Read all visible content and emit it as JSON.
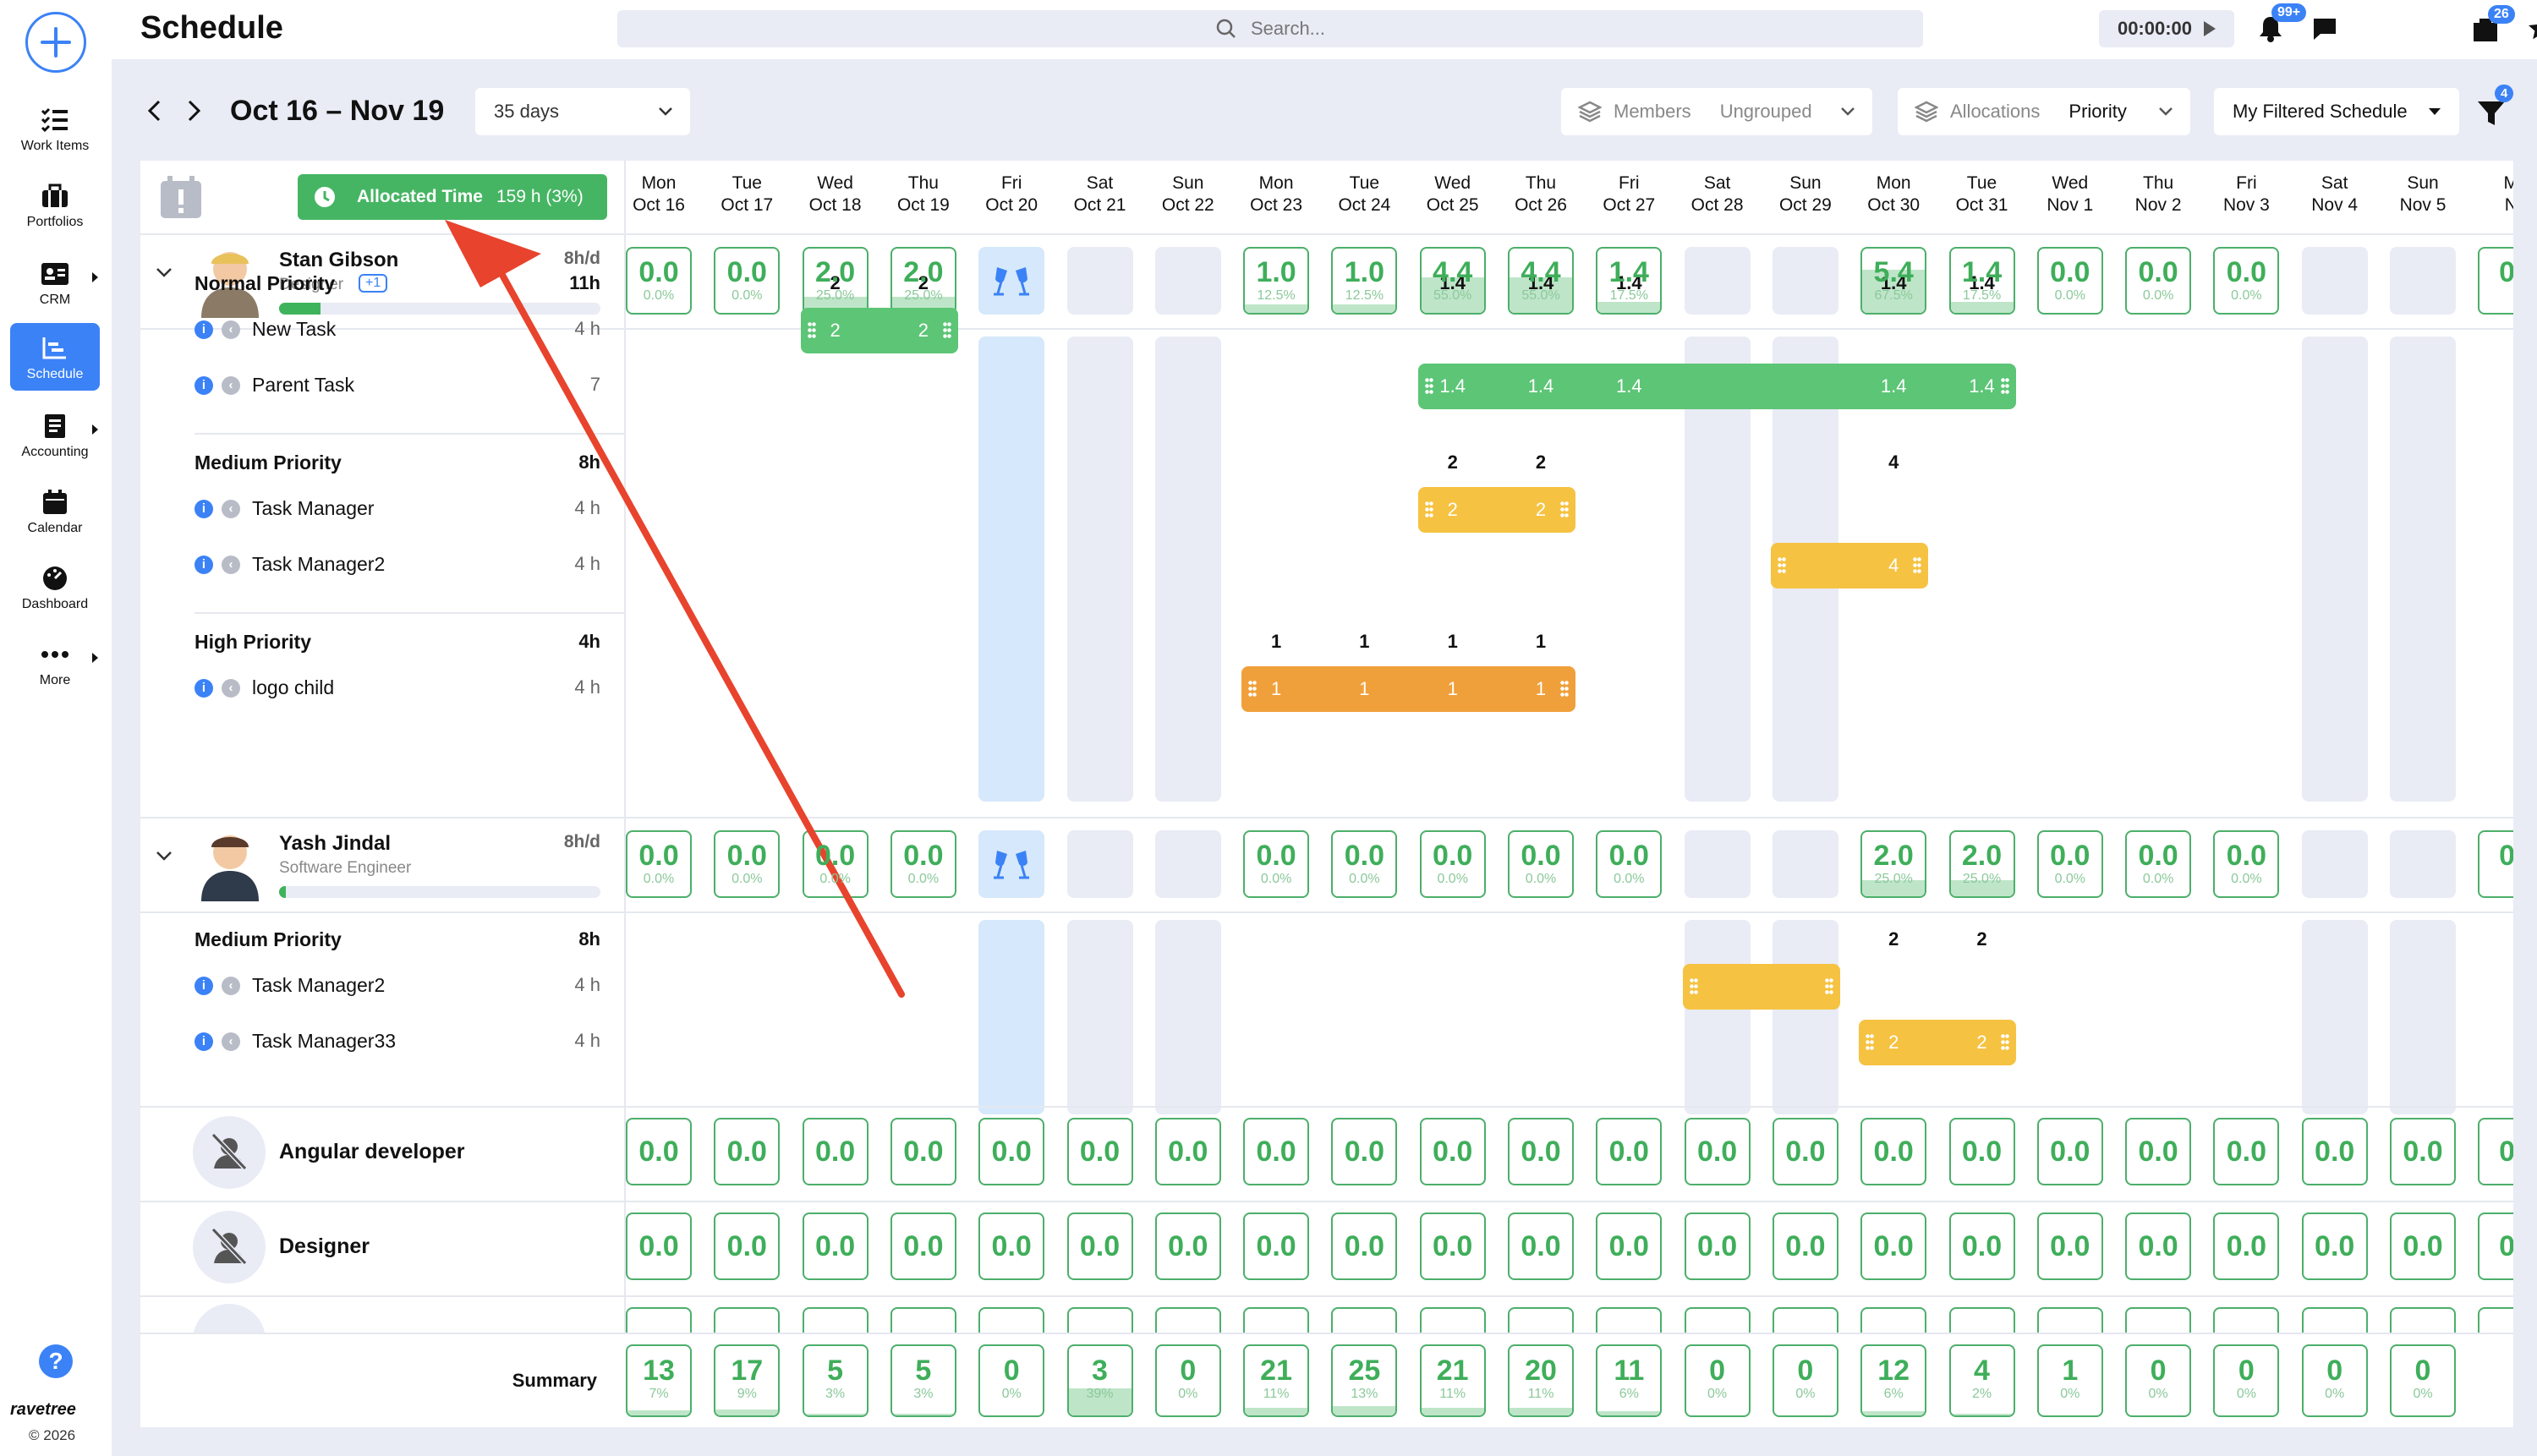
{
  "app": {
    "title": "Schedule",
    "brand": "ravetree",
    "copyright": "© 2026"
  },
  "sidebar": {
    "items": [
      {
        "label": "Work Items",
        "icon": "work-items-icon"
      },
      {
        "label": "Portfolios",
        "icon": "portfolio-icon"
      },
      {
        "label": "CRM",
        "icon": "crm-icon"
      },
      {
        "label": "Schedule",
        "icon": "schedule-icon"
      },
      {
        "label": "Accounting",
        "icon": "accounting-icon"
      },
      {
        "label": "Calendar",
        "icon": "calendar-icon"
      },
      {
        "label": "Dashboard",
        "icon": "dashboard-icon"
      },
      {
        "label": "More",
        "icon": "more-icon"
      }
    ]
  },
  "header": {
    "search_placeholder": "Search...",
    "timer": "00:00:00",
    "notifications_badge": "99+",
    "inbox_badge": "26"
  },
  "toolbar": {
    "date_range": "Oct 16 – Nov 19",
    "range_select": "35 days",
    "members_label": "Members",
    "grouping": "Ungrouped",
    "allocations_label": "Allocations",
    "allocations_value": "Priority",
    "filter_select": "My Filtered Schedule",
    "filter_badge": "4"
  },
  "allocated": {
    "label": "Allocated Time",
    "value": "159 h (3%)"
  },
  "days": [
    {
      "dow": "Mon",
      "date": "Oct 16"
    },
    {
      "dow": "Tue",
      "date": "Oct 17"
    },
    {
      "dow": "Wed",
      "date": "Oct 18"
    },
    {
      "dow": "Thu",
      "date": "Oct 19"
    },
    {
      "dow": "Fri",
      "date": "Oct 20"
    },
    {
      "dow": "Sat",
      "date": "Oct 21"
    },
    {
      "dow": "Sun",
      "date": "Oct 22"
    },
    {
      "dow": "Mon",
      "date": "Oct 23"
    },
    {
      "dow": "Tue",
      "date": "Oct 24"
    },
    {
      "dow": "Wed",
      "date": "Oct 25"
    },
    {
      "dow": "Thu",
      "date": "Oct 26"
    },
    {
      "dow": "Fri",
      "date": "Oct 27"
    },
    {
      "dow": "Sat",
      "date": "Oct 28"
    },
    {
      "dow": "Sun",
      "date": "Oct 29"
    },
    {
      "dow": "Mon",
      "date": "Oct 30"
    },
    {
      "dow": "Tue",
      "date": "Oct 31"
    },
    {
      "dow": "Wed",
      "date": "Nov 1"
    },
    {
      "dow": "Thu",
      "date": "Nov 2"
    },
    {
      "dow": "Fri",
      "date": "Nov 3"
    },
    {
      "dow": "Sat",
      "date": "Nov 4"
    },
    {
      "dow": "Sun",
      "date": "Nov 5"
    },
    {
      "dow": "M",
      "date": "N"
    }
  ],
  "members": [
    {
      "name": "Stan Gibson",
      "role": "Designer",
      "extra": "+1",
      "capacity": "8h/d",
      "progress": 0.13,
      "cells": [
        {
          "v": "0.0",
          "p": "0.0%",
          "fill": 0
        },
        {
          "v": "0.0",
          "p": "0.0%",
          "fill": 0
        },
        {
          "v": "2.0",
          "p": "25.0%",
          "fill": 0.25
        },
        {
          "v": "2.0",
          "p": "25.0%",
          "fill": 0.25
        },
        {
          "type": "holiday"
        },
        {
          "type": "off"
        },
        {
          "type": "off"
        },
        {
          "v": "1.0",
          "p": "12.5%",
          "fill": 0.125
        },
        {
          "v": "1.0",
          "p": "12.5%",
          "fill": 0.125
        },
        {
          "v": "4.4",
          "p": "55.0%",
          "fill": 0.55
        },
        {
          "v": "4.4",
          "p": "55.0%",
          "fill": 0.55
        },
        {
          "v": "1.4",
          "p": "17.5%",
          "fill": 0.175
        },
        {
          "type": "off"
        },
        {
          "type": "off"
        },
        {
          "v": "5.4",
          "p": "67.5%",
          "fill": 0.675
        },
        {
          "v": "1.4",
          "p": "17.5%",
          "fill": 0.175
        },
        {
          "v": "0.0",
          "p": "0.0%",
          "fill": 0
        },
        {
          "v": "0.0",
          "p": "0.0%",
          "fill": 0
        },
        {
          "v": "0.0",
          "p": "0.0%",
          "fill": 0
        },
        {
          "type": "off"
        },
        {
          "type": "off"
        },
        {
          "v": "0.",
          "p": "",
          "fill": 0
        }
      ],
      "groups": [
        {
          "name": "Normal Priority",
          "hours": "11h",
          "totals": [
            {
              "day": 2,
              "v": "2"
            },
            {
              "day": 3,
              "v": "2"
            },
            {
              "day": 9,
              "v": "1.4"
            },
            {
              "day": 10,
              "v": "1.4"
            },
            {
              "day": 11,
              "v": "1.4"
            },
            {
              "day": 14,
              "v": "1.4"
            },
            {
              "day": 15,
              "v": "1.4"
            }
          ],
          "tasks": [
            {
              "name": "New Task",
              "hours": "4 h",
              "bar": {
                "start": 2,
                "end": 3,
                "color": "#5cc576",
                "labels": [
                  {
                    "day": 2,
                    "v": "2"
                  },
                  {
                    "day": 3,
                    "v": "2"
                  }
                ]
              }
            },
            {
              "name": "Parent Task",
              "hours": "7",
              "bar": {
                "start": 9,
                "end": 15,
                "color": "#5cc576",
                "labels": [
                  {
                    "day": 9,
                    "v": "1.4"
                  },
                  {
                    "day": 10,
                    "v": "1.4"
                  },
                  {
                    "day": 11,
                    "v": "1.4"
                  },
                  {
                    "day": 14,
                    "v": "1.4"
                  },
                  {
                    "day": 15,
                    "v": "1.4"
                  }
                ]
              }
            }
          ]
        },
        {
          "name": "Medium Priority",
          "hours": "8h",
          "totals": [
            {
              "day": 9,
              "v": "2"
            },
            {
              "day": 10,
              "v": "2"
            },
            {
              "day": 14,
              "v": "4"
            }
          ],
          "tasks": [
            {
              "name": "Task Manager",
              "hours": "4 h",
              "bar": {
                "start": 9,
                "end": 10,
                "color": "#f5c242",
                "labels": [
                  {
                    "day": 9,
                    "v": "2"
                  },
                  {
                    "day": 10,
                    "v": "2"
                  }
                ]
              }
            },
            {
              "name": "Task Manager2",
              "hours": "4 h",
              "bar": {
                "start": 13,
                "end": 14,
                "color": "#f5c242",
                "labels": [
                  {
                    "day": 14,
                    "v": "4"
                  }
                ]
              }
            }
          ]
        },
        {
          "name": "High Priority",
          "hours": "4h",
          "totals": [
            {
              "day": 7,
              "v": "1"
            },
            {
              "day": 8,
              "v": "1"
            },
            {
              "day": 9,
              "v": "1"
            },
            {
              "day": 10,
              "v": "1"
            }
          ],
          "tasks": [
            {
              "name": "logo child",
              "hours": "4 h",
              "bar": {
                "start": 7,
                "end": 10,
                "color": "#f0a03a",
                "labels": [
                  {
                    "day": 7,
                    "v": "1"
                  },
                  {
                    "day": 8,
                    "v": "1"
                  },
                  {
                    "day": 9,
                    "v": "1"
                  },
                  {
                    "day": 10,
                    "v": "1"
                  }
                ]
              }
            }
          ]
        }
      ]
    },
    {
      "name": "Yash Jindal",
      "role": "Software Engineer",
      "extra": "",
      "capacity": "8h/d",
      "progress": 0.02,
      "cells": [
        {
          "v": "0.0",
          "p": "0.0%",
          "fill": 0
        },
        {
          "v": "0.0",
          "p": "0.0%",
          "fill": 0
        },
        {
          "v": "0.0",
          "p": "0.0%",
          "fill": 0
        },
        {
          "v": "0.0",
          "p": "0.0%",
          "fill": 0
        },
        {
          "type": "holiday"
        },
        {
          "type": "off"
        },
        {
          "type": "off"
        },
        {
          "v": "0.0",
          "p": "0.0%",
          "fill": 0
        },
        {
          "v": "0.0",
          "p": "0.0%",
          "fill": 0
        },
        {
          "v": "0.0",
          "p": "0.0%",
          "fill": 0
        },
        {
          "v": "0.0",
          "p": "0.0%",
          "fill": 0
        },
        {
          "v": "0.0",
          "p": "0.0%",
          "fill": 0
        },
        {
          "type": "off"
        },
        {
          "type": "off"
        },
        {
          "v": "2.0",
          "p": "25.0%",
          "fill": 0.25
        },
        {
          "v": "2.0",
          "p": "25.0%",
          "fill": 0.25
        },
        {
          "v": "0.0",
          "p": "0.0%",
          "fill": 0
        },
        {
          "v": "0.0",
          "p": "0.0%",
          "fill": 0
        },
        {
          "v": "0.0",
          "p": "0.0%",
          "fill": 0
        },
        {
          "type": "off"
        },
        {
          "type": "off"
        },
        {
          "v": "0.",
          "p": "",
          "fill": 0
        }
      ],
      "groups": [
        {
          "name": "Medium Priority",
          "hours": "8h",
          "totals": [
            {
              "day": 14,
              "v": "2"
            },
            {
              "day": 15,
              "v": "2"
            }
          ],
          "tasks": [
            {
              "name": "Task Manager2",
              "hours": "4 h",
              "bar": {
                "start": 12,
                "end": 13,
                "color": "#f5c242",
                "labels": []
              }
            },
            {
              "name": "Task Manager33",
              "hours": "4 h",
              "bar": {
                "start": 14,
                "end": 15,
                "color": "#f5c242",
                "labels": [
                  {
                    "day": 14,
                    "v": "2"
                  },
                  {
                    "day": 15,
                    "v": "2"
                  }
                ]
              }
            }
          ]
        }
      ]
    }
  ],
  "roles": [
    {
      "name": "Angular developer",
      "cells": [
        "0.0",
        "0.0",
        "0.0",
        "0.0",
        "0.0",
        "0.0",
        "0.0",
        "0.0",
        "0.0",
        "0.0",
        "0.0",
        "0.0",
        "0.0",
        "0.0",
        "0.0",
        "0.0",
        "0.0",
        "0.0",
        "0.0",
        "0.0",
        "0.0",
        "0."
      ]
    },
    {
      "name": "Designer",
      "cells": [
        "0.0",
        "0.0",
        "0.0",
        "0.0",
        "0.0",
        "0.0",
        "0.0",
        "0.0",
        "0.0",
        "0.0",
        "0.0",
        "0.0",
        "0.0",
        "0.0",
        "0.0",
        "0.0",
        "0.0",
        "0.0",
        "0.0",
        "0.0",
        "0.0",
        "0."
      ]
    }
  ],
  "summary": {
    "label": "Summary",
    "cells": [
      {
        "v": "13",
        "p": "7%",
        "fill": 0.07
      },
      {
        "v": "17",
        "p": "9%",
        "fill": 0.09
      },
      {
        "v": "5",
        "p": "3%",
        "fill": 0.03
      },
      {
        "v": "5",
        "p": "3%",
        "fill": 0.03
      },
      {
        "v": "0",
        "p": "0%",
        "fill": 0
      },
      {
        "v": "3",
        "p": "39%",
        "fill": 0.39
      },
      {
        "v": "0",
        "p": "0%",
        "fill": 0
      },
      {
        "v": "21",
        "p": "11%",
        "fill": 0.11
      },
      {
        "v": "25",
        "p": "13%",
        "fill": 0.13
      },
      {
        "v": "21",
        "p": "11%",
        "fill": 0.11
      },
      {
        "v": "20",
        "p": "11%",
        "fill": 0.11
      },
      {
        "v": "11",
        "p": "6%",
        "fill": 0.06
      },
      {
        "v": "0",
        "p": "0%",
        "fill": 0
      },
      {
        "v": "0",
        "p": "0%",
        "fill": 0
      },
      {
        "v": "12",
        "p": "6%",
        "fill": 0.06
      },
      {
        "v": "4",
        "p": "2%",
        "fill": 0.02
      },
      {
        "v": "1",
        "p": "0%",
        "fill": 0
      },
      {
        "v": "0",
        "p": "0%",
        "fill": 0
      },
      {
        "v": "0",
        "p": "0%",
        "fill": 0
      },
      {
        "v": "0",
        "p": "0%",
        "fill": 0
      },
      {
        "v": "0",
        "p": "0%",
        "fill": 0
      },
      {
        "v": "",
        "p": "",
        "fill": 0
      }
    ]
  },
  "colors": {
    "accent": "#3b82f6",
    "green": "#4caf6a",
    "annotation": "#e8432d"
  }
}
